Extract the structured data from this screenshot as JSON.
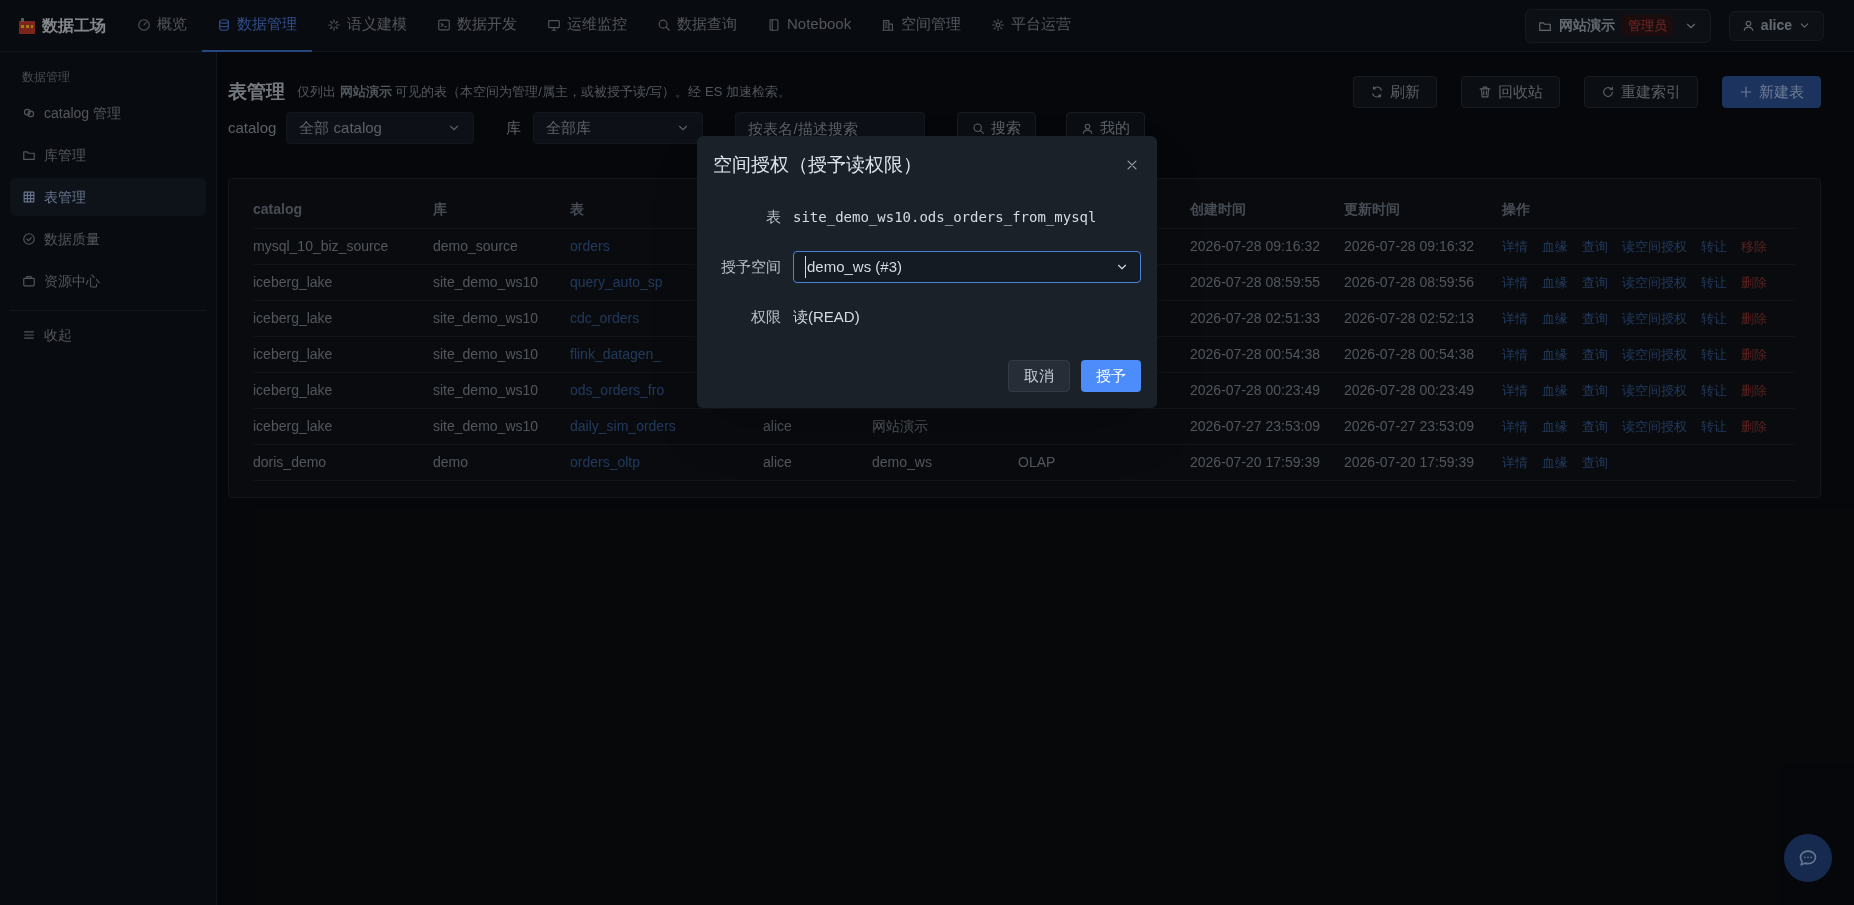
{
  "app": {
    "name": "数据工场"
  },
  "nav": [
    {
      "label": "概览",
      "selected": false
    },
    {
      "label": "数据管理",
      "selected": true
    },
    {
      "label": "语义建模",
      "selected": false
    },
    {
      "label": "数据开发",
      "selected": false
    },
    {
      "label": "运维监控",
      "selected": false
    },
    {
      "label": "数据查询",
      "selected": false
    },
    {
      "label": "Notebook",
      "selected": false
    },
    {
      "label": "空间管理",
      "selected": false
    },
    {
      "label": "平台运营",
      "selected": false
    }
  ],
  "workspace_switcher": {
    "name": "网站演示",
    "role": "管理员"
  },
  "user_menu": {
    "name": "alice"
  },
  "sidebar": {
    "heading": "数据管理",
    "items": [
      {
        "label": "catalog 管理",
        "selected": false
      },
      {
        "label": "库管理",
        "selected": false
      },
      {
        "label": "表管理",
        "selected": true
      },
      {
        "label": "数据质量",
        "selected": false
      },
      {
        "label": "资源中心",
        "selected": false
      }
    ],
    "collapse": "收起"
  },
  "page": {
    "title": "表管理",
    "subtitle": "仅列出 **网站演示** 可见的表（本空间为管理/属主，或被授予读/写）。经 ES 加速检索。",
    "actions": [
      {
        "label": "刷新",
        "kind": "default"
      },
      {
        "label": "回收站",
        "kind": "default"
      },
      {
        "label": "重建索引",
        "kind": "default"
      },
      {
        "label": "新建表",
        "kind": "primary"
      }
    ]
  },
  "filters": {
    "catalog_label": "catalog",
    "catalog_value": "全部 catalog",
    "database_label": "库",
    "database_value": "全部库",
    "search_placeholder": "按表名/描述搜索",
    "search_button": "搜索",
    "mine_button": "我的"
  },
  "table": {
    "columns": [
      "catalog",
      "库",
      "表",
      "创建时间",
      "更新时间",
      "操作"
    ],
    "rows": [
      {
        "catalog": "mysql_10_biz_source",
        "database": "demo_source",
        "table": "orders",
        "created": "2026-07-28 09:16:32",
        "updated": "2026-07-28 09:16:32",
        "actions": [
          {
            "label": "详情",
            "kind": "link"
          },
          {
            "label": "血缘",
            "kind": "link"
          },
          {
            "label": "查询",
            "kind": "link"
          },
          {
            "label": "读空间授权",
            "kind": "link"
          },
          {
            "label": "转让",
            "kind": "link"
          },
          {
            "label": "移除",
            "kind": "danger"
          }
        ]
      },
      {
        "catalog": "iceberg_lake",
        "database": "site_demo_ws10",
        "table": "query_auto_sp",
        "created": "2026-07-28 08:59:55",
        "updated": "2026-07-28 08:59:56",
        "actions": [
          {
            "label": "详情",
            "kind": "link"
          },
          {
            "label": "血缘",
            "kind": "link"
          },
          {
            "label": "查询",
            "kind": "link"
          },
          {
            "label": "读空间授权",
            "kind": "link"
          },
          {
            "label": "转让",
            "kind": "link"
          },
          {
            "label": "删除",
            "kind": "danger"
          }
        ]
      },
      {
        "catalog": "iceberg_lake",
        "database": "site_demo_ws10",
        "table": "cdc_orders",
        "created": "2026-07-28 02:51:33",
        "updated": "2026-07-28 02:52:13",
        "actions": [
          {
            "label": "详情",
            "kind": "link"
          },
          {
            "label": "血缘",
            "kind": "link"
          },
          {
            "label": "查询",
            "kind": "link"
          },
          {
            "label": "读空间授权",
            "kind": "link"
          },
          {
            "label": "转让",
            "kind": "link"
          },
          {
            "label": "删除",
            "kind": "danger"
          }
        ]
      },
      {
        "catalog": "iceberg_lake",
        "database": "site_demo_ws10",
        "table": "flink_datagen_",
        "created": "2026-07-28 00:54:38",
        "updated": "2026-07-28 00:54:38",
        "actions": [
          {
            "label": "详情",
            "kind": "link"
          },
          {
            "label": "血缘",
            "kind": "link"
          },
          {
            "label": "查询",
            "kind": "link"
          },
          {
            "label": "读空间授权",
            "kind": "link"
          },
          {
            "label": "转让",
            "kind": "link"
          },
          {
            "label": "删除",
            "kind": "danger"
          }
        ]
      },
      {
        "catalog": "iceberg_lake",
        "database": "site_demo_ws10",
        "table": "ods_orders_fro",
        "created": "2026-07-28 00:23:49",
        "updated": "2026-07-28 00:23:49",
        "actions": [
          {
            "label": "详情",
            "kind": "link"
          },
          {
            "label": "血缘",
            "kind": "link"
          },
          {
            "label": "查询",
            "kind": "link"
          },
          {
            "label": "读空间授权",
            "kind": "link"
          },
          {
            "label": "转让",
            "kind": "link"
          },
          {
            "label": "删除",
            "kind": "danger"
          }
        ]
      },
      {
        "catalog": "iceberg_lake",
        "database": "site_demo_ws10",
        "table": "daily_sim_orders",
        "owner": "alice",
        "workspace": "网站演示",
        "created": "2026-07-27 23:53:09",
        "updated": "2026-07-27 23:53:09",
        "actions": [
          {
            "label": "详情",
            "kind": "link"
          },
          {
            "label": "血缘",
            "kind": "link"
          },
          {
            "label": "查询",
            "kind": "link"
          },
          {
            "label": "读空间授权",
            "kind": "link"
          },
          {
            "label": "转让",
            "kind": "link"
          },
          {
            "label": "删除",
            "kind": "danger"
          }
        ]
      },
      {
        "catalog": "doris_demo",
        "database": "demo",
        "table": "orders_oltp",
        "owner": "alice",
        "workspace": "demo_ws",
        "type": "OLAP",
        "created": "2026-07-20 17:59:39",
        "updated": "2026-07-20 17:59:39",
        "actions": [
          {
            "label": "详情",
            "kind": "link"
          },
          {
            "label": "血缘",
            "kind": "link"
          },
          {
            "label": "查询",
            "kind": "link"
          }
        ]
      }
    ]
  },
  "dialog": {
    "title": "空间授权（授予读权限）",
    "fields": [
      {
        "label": "表",
        "kind": "code",
        "value": "site_demo_ws10.ods_orders_from_mysql"
      },
      {
        "label": "授予空间",
        "kind": "select",
        "value": "demo_ws (#3)"
      },
      {
        "label": "权限",
        "kind": "text",
        "value": "读(READ)"
      }
    ],
    "cancel": "取消",
    "confirm": "授予"
  }
}
